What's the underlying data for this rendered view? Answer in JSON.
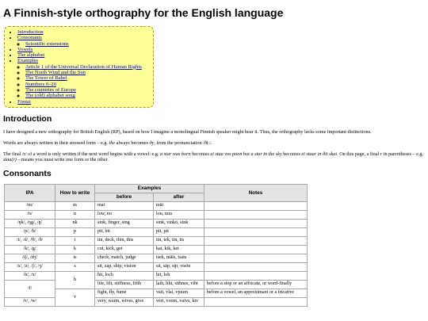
{
  "title": "A Finnish-style orthography for the English language",
  "toc": {
    "introduction": "Introduction",
    "consonants": "Consonants",
    "scientific_extensions": "Scientific extensions",
    "vowels": "Vowels",
    "alphabet": "The alphabet",
    "examples": "Examples",
    "example_items": [
      "Article 1 of the Universal Declaration of Human Rights",
      "The North Wind and the Sun",
      "The Tower of Babel",
      "Numbers 0–20",
      "The countries of Europe",
      "The (old) alphabet song"
    ],
    "footer": "Footer"
  },
  "introduction": {
    "heading": "Introduction",
    "p1": "I have designed a new orthography for British English (RP), based on how I imagine a monolingual Finnish speaker might hear it. Thus, the orthography lacks some important distinctions.",
    "p2_before": "Words are always written in their stressed form – e.g. ",
    "p2_the": "the",
    "p2_after": " always becomes ",
    "p2_dy": "ðy",
    "p2_end": ", from the pronunciation /ðiː/.",
    "p3_a": "The final /r/ of a word is only written if the next word begins with a vowel: e.g. ",
    "p3_b": "a star was born",
    "p3_c": " becomes ",
    "p3_d": "ei staa vos poon",
    "p3_e": " but ",
    "p3_f": "a star in the sky",
    "p3_g": " becomes ",
    "p3_h": "ei staar in ðii skai",
    "p3_i": ". On this page, a final ",
    "p3_j": "r",
    "p3_k": " in parentheses – e.g. ",
    "p3_l": "staa(r)",
    "p3_m": " – means you must write one form or the other."
  },
  "consonants": {
    "heading": "Consonants",
    "headers": {
      "ipa": "IPA",
      "how": "How to write",
      "examples": "Examples",
      "before": "before",
      "after": "after",
      "notes": "Notes"
    },
    "rows": [
      {
        "ipa": "/m/",
        "how": "m",
        "before": "mat",
        "after": "mät",
        "notes": ""
      },
      {
        "ipa": "/n/",
        "how": "n",
        "before": "low, no",
        "after": "lou, nou",
        "notes": ""
      },
      {
        "ipa": "/ŋk/, /ŋg/, /ŋ/",
        "how": "nk",
        "before": "sink, finger, sing",
        "after": "sink, vinkö, sink",
        "notes": ""
      },
      {
        "ipa": "/p/, /b/",
        "how": "p",
        "before": "pit, bit",
        "after": "pit, pit",
        "notes": ""
      },
      {
        "ipa": "/t/, /d/, /θ/, /ð/",
        "how": "t",
        "before": "tin, deck, thin, this",
        "after": "tin, tek, tin, tis",
        "notes": ""
      },
      {
        "ipa": "/k/, /g/",
        "how": "k",
        "before": "cut, kick, get",
        "after": "kat, kik, ket",
        "notes": ""
      },
      {
        "ipa": "/tʃ/, /dʒ/",
        "how": "ts",
        "before": "check, match, judge",
        "after": "tsek, mäts, tsats",
        "notes": ""
      },
      {
        "ipa": "/s/, /z/, /ʃ/, /ʒ/",
        "how": "s",
        "before": "sit, zap, ship, vision",
        "after": "sit, säp, sip, visön",
        "notes": ""
      },
      {
        "ipa": "/h/, /x/",
        "how": "h",
        "before": "hit, loch",
        "after": "hit, loh",
        "notes": ""
      },
      {
        "ipa": "",
        "how": "",
        "before": "life, lift, stiffness, fifth",
        "after": "laih, lihi, stihnes, viht",
        "notes": "before a stop or an affricate, or word-finally"
      },
      {
        "ipa": "/f/",
        "how": "v",
        "before": "fight, fly, fume",
        "after": "vait, vlai, vjuum",
        "notes": "before a vowel, an approximant or a fricative"
      },
      {
        "ipa": "/v/, /w/",
        "how": "",
        "before": "very, warm, wives, give",
        "after": "veri, voom, vaivs, kiv",
        "notes": ""
      }
    ]
  }
}
